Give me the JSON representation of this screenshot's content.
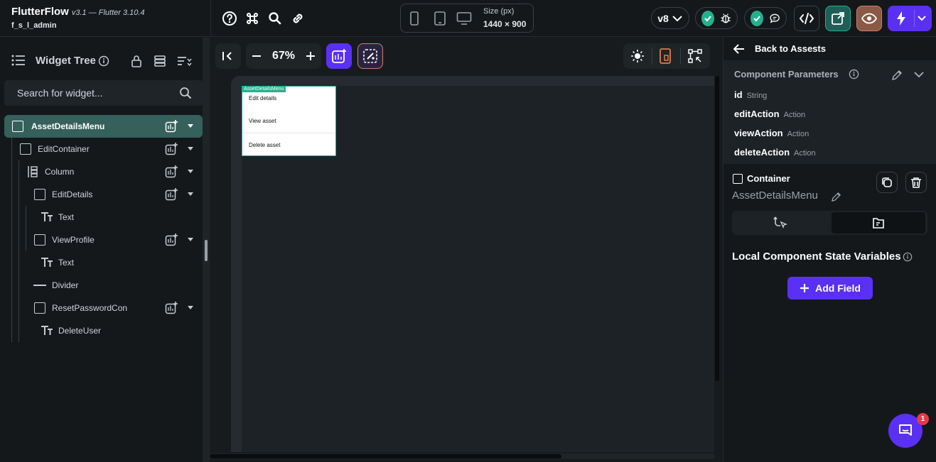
{
  "app": {
    "name": "FlutterFlow",
    "version": "v3.1 — Flutter 3.10.4",
    "project": "f_s_l_admin"
  },
  "toolbar": {
    "size_label": "Size (px)",
    "size_value": "1440 × 900",
    "version_badge": "v8"
  },
  "widget_tree": {
    "title": "Widget Tree",
    "search_placeholder": "Search for widget...",
    "nodes": [
      {
        "label": "AssetDetailsMenu"
      },
      {
        "label": "EditContainer"
      },
      {
        "label": "Column"
      },
      {
        "label": "EditDetails"
      },
      {
        "label": "Text"
      },
      {
        "label": "ViewProfile"
      },
      {
        "label": "Text"
      },
      {
        "label": "Divider"
      },
      {
        "label": "ResetPasswordCon"
      },
      {
        "label": "DeleteUser"
      }
    ]
  },
  "canvas": {
    "zoom": "67%",
    "component_tag": "AssetDetailsMenu",
    "menu_items": [
      "Edit details",
      "View asset",
      "Delete asset"
    ]
  },
  "properties": {
    "back_label": "Back to Assests",
    "params_title": "Component Parameters",
    "params": [
      {
        "name": "id",
        "type": "String"
      },
      {
        "name": "editAction",
        "type": "Action"
      },
      {
        "name": "viewAction",
        "type": "Action"
      },
      {
        "name": "deleteAction",
        "type": "Action"
      }
    ],
    "container_title": "Container",
    "component_name": "AssetDetailsMenu",
    "local_state_title": "Local Component State Variables",
    "add_field_label": "Add Field",
    "chat_badge": "1"
  },
  "colors": {
    "accent": "#5a31f4",
    "success": "#24b08f",
    "selected_row": "#35605c",
    "background": "#14181b"
  }
}
